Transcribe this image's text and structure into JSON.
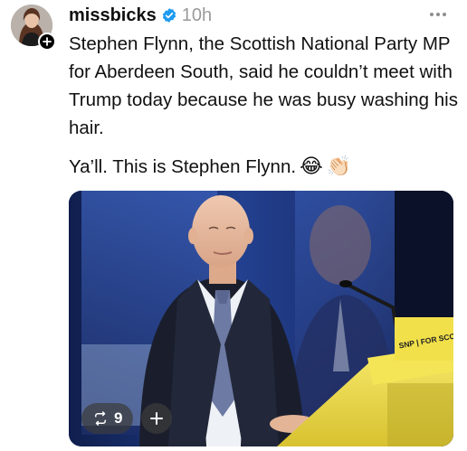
{
  "post": {
    "author": {
      "username": "missbicks",
      "verified": true,
      "avatar_icon": "avatar-photo"
    },
    "timestamp": "10h",
    "more_icon": "more-horizontal-icon",
    "text_paragraph_1": "Stephen Flynn, the Scottish National Party MP for Aberdeen South, said he couldn’t meet with Trump today because he was busy washing his hair.",
    "text_paragraph_2": "Ya’ll. This is Stephen Flynn.",
    "emojis": [
      "😂",
      "👏🏻"
    ],
    "media": {
      "podium_sign_text": "SNP | FOR SCOTLAND",
      "repost_count": "9"
    }
  },
  "colors": {
    "text": "#101010",
    "muted": "#9a9a9a",
    "verified_blue": "#1d9bf0",
    "podium_yellow": "#f2e04a"
  }
}
